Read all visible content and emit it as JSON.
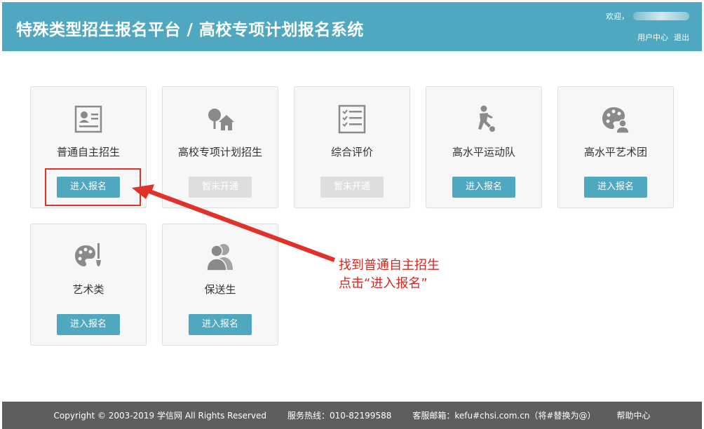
{
  "header": {
    "title": "特殊类型招生报名平台 / 高校专项计划报名系统",
    "welcome": "欢迎，",
    "user_center": "用户中心",
    "logout": "退出"
  },
  "cards": [
    {
      "label": "普通自主招生",
      "button": "进入报名",
      "state": "active",
      "icon": "id-card-icon"
    },
    {
      "label": "高校专项计划招生",
      "button": "暂未开通",
      "state": "disabled",
      "icon": "tree-house-icon"
    },
    {
      "label": "综合评价",
      "button": "暂未开通",
      "state": "disabled",
      "icon": "checklist-icon"
    },
    {
      "label": "高水平运动队",
      "button": "进入报名",
      "state": "active",
      "icon": "athlete-icon"
    },
    {
      "label": "高水平艺术团",
      "button": "进入报名",
      "state": "active",
      "icon": "palette-person-icon"
    },
    {
      "label": "艺术类",
      "button": "进入报名",
      "state": "active",
      "icon": "palette-brush-icon"
    },
    {
      "label": "保送生",
      "button": "进入报名",
      "state": "active",
      "icon": "users-icon"
    }
  ],
  "annotation": {
    "line1": "找到普通自主招生",
    "line2": "点击“进入报名”"
  },
  "footer": {
    "copyright": "Copyright © 2003-2019 学信网 All Rights Reserved",
    "hotline": "服务热线：010-82199588",
    "email": "客服邮箱：kefu#chsi.com.cn（将#替换为@）",
    "help": "帮助中心"
  },
  "colors": {
    "accent": "#4fa8bf",
    "annotation": "#d8261f",
    "footer_bg": "#5e5e5e",
    "disabled": "#dedede"
  }
}
